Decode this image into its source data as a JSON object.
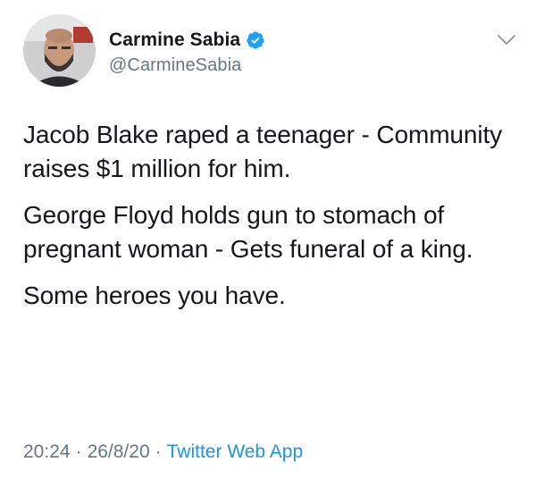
{
  "tweet": {
    "author": {
      "display_name": "Carmine Sabia",
      "handle": "@CarmineSabia",
      "verified": true,
      "avatar_icon": "user-avatar-photo"
    },
    "paragraphs": [
      "Jacob Blake raped a teenager - Community raises $1 million for him.",
      "George Floyd holds gun to stomach of pregnant woman - Gets funeral of a king.",
      "Some heroes you have."
    ],
    "time": "20:24",
    "date": "26/8/20",
    "source": "Twitter Web App",
    "separator": "·",
    "menu_icon": "chevron-down-icon"
  },
  "colors": {
    "text": "#14171a",
    "secondary": "#657786",
    "link": "#1b95e0",
    "verified": "#1da1f2"
  }
}
